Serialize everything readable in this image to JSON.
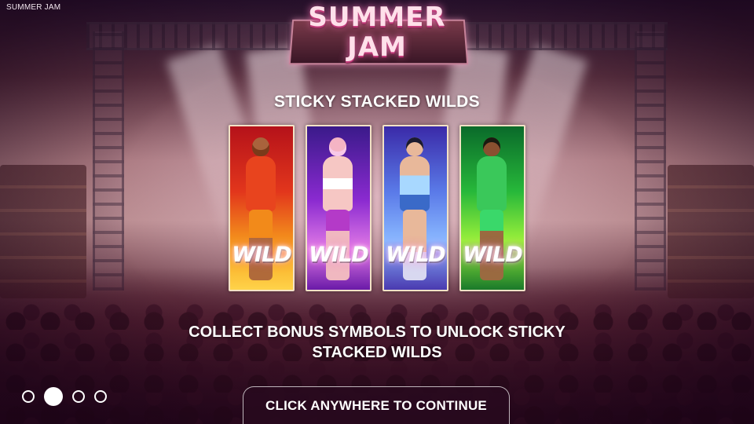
{
  "app": {
    "title": "SUMMER JAM"
  },
  "logo": {
    "line1": "SUMMER",
    "line2": "JAM"
  },
  "feature": {
    "title": "STICKY STACKED WILDS",
    "description": "COLLECT BONUS SYMBOLS TO UNLOCK STICKY STACKED WILDS"
  },
  "cards": [
    {
      "label": "WILD",
      "theme_color": "#e8441e"
    },
    {
      "label": "WILD",
      "theme_color": "#8a2ad0"
    },
    {
      "label": "WILD",
      "theme_color": "#5a7ae8"
    },
    {
      "label": "WILD",
      "theme_color": "#27b83a"
    }
  ],
  "pagination": {
    "total": 4,
    "active_index": 1
  },
  "continue_button": {
    "label": "CLICK ANYWHERE TO CONTINUE"
  },
  "colors": {
    "text": "#ffffff",
    "card_border": "#f3e2c6",
    "button_bg": "#280a1e"
  }
}
